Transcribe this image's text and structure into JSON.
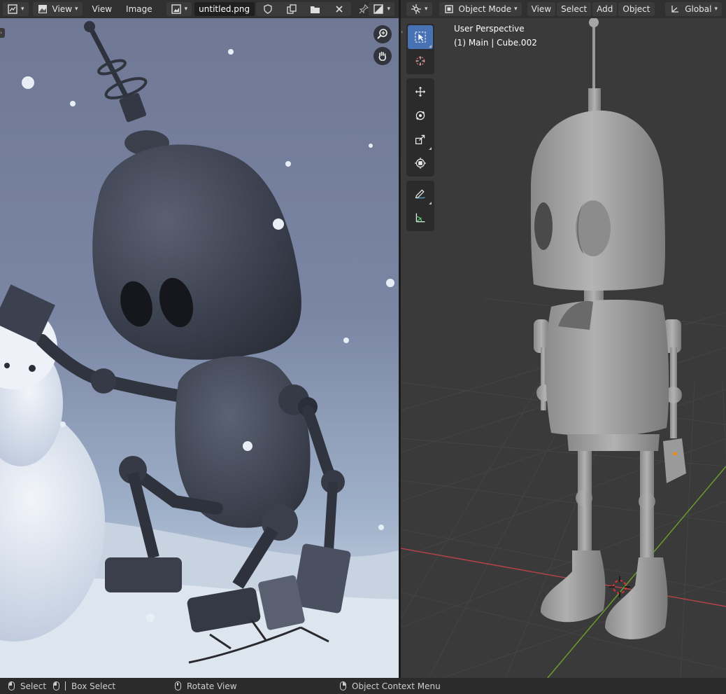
{
  "image_editor": {
    "header": {
      "editor_type_icon": "image-editor-icon",
      "view_mode_label": "View",
      "menu_view": "View",
      "menu_image": "Image",
      "image_browse_icon": "image-browse-icon",
      "image_name": "untitled.png",
      "fake_user_icon": "shield-icon",
      "new_image_icon": "duplicate-icon",
      "open_image_icon": "folder-icon",
      "unlink_icon": "close-icon",
      "pin_icon": "pin-icon",
      "display_channels_icon": "display-channels-icon"
    },
    "navigation": {
      "zoom_icon": "zoom-icon",
      "pan_icon": "hand-icon"
    }
  },
  "viewport": {
    "header": {
      "editor_type_icon": "3d-viewport-icon",
      "mode_label": "Object Mode",
      "menu_view": "View",
      "menu_select": "Select",
      "menu_add": "Add",
      "menu_object": "Object",
      "transform_orientation": "Global"
    },
    "overlay": {
      "perspective": "User Perspective",
      "collection_object": "(1) Main | Cube.002"
    },
    "toolbar": {
      "tools": [
        "select-box-icon",
        "cursor-icon",
        "move-icon",
        "rotate-icon",
        "scale-icon",
        "transform-icon",
        "annotate-icon",
        "measure-icon"
      ],
      "active_tool": "select-box-icon"
    },
    "colors": {
      "grid_line": "#444444",
      "x_axis": "#b3424a",
      "y_axis": "#6a9c2c",
      "active_tool": "#4772b3"
    }
  },
  "status_bar": {
    "left_click": "Select",
    "left_drag": "Box Select",
    "middle_click": "Rotate View",
    "right_click": "Object Context Menu"
  }
}
